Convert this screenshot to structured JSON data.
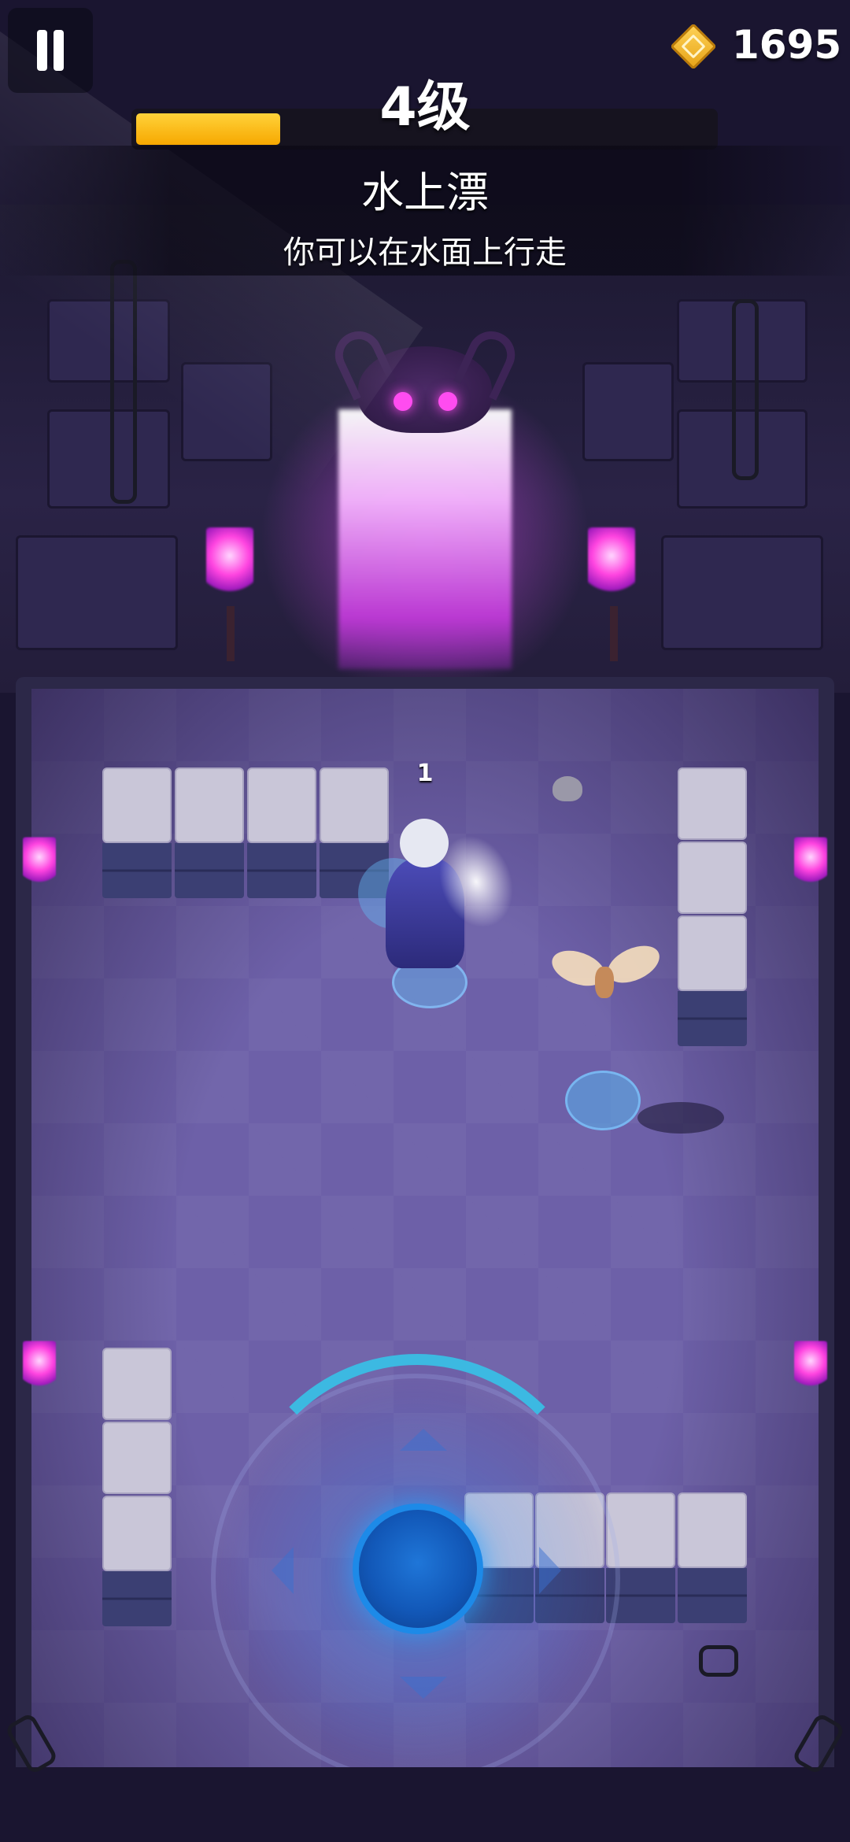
{
  "hud": {
    "pause_icon": "pause-icon",
    "currency_icon": "gold-gem-icon",
    "gold": "1695",
    "level_label": "4级",
    "xp_progress": 0.25
  },
  "skill_popup": {
    "name": "水上漂",
    "description": "你可以在水面上行走"
  },
  "battle": {
    "combo_count": "1"
  },
  "colors": {
    "xp_fill": "#f7a800",
    "joystick": "#1d8ae8",
    "torch": "#ff44e0"
  }
}
